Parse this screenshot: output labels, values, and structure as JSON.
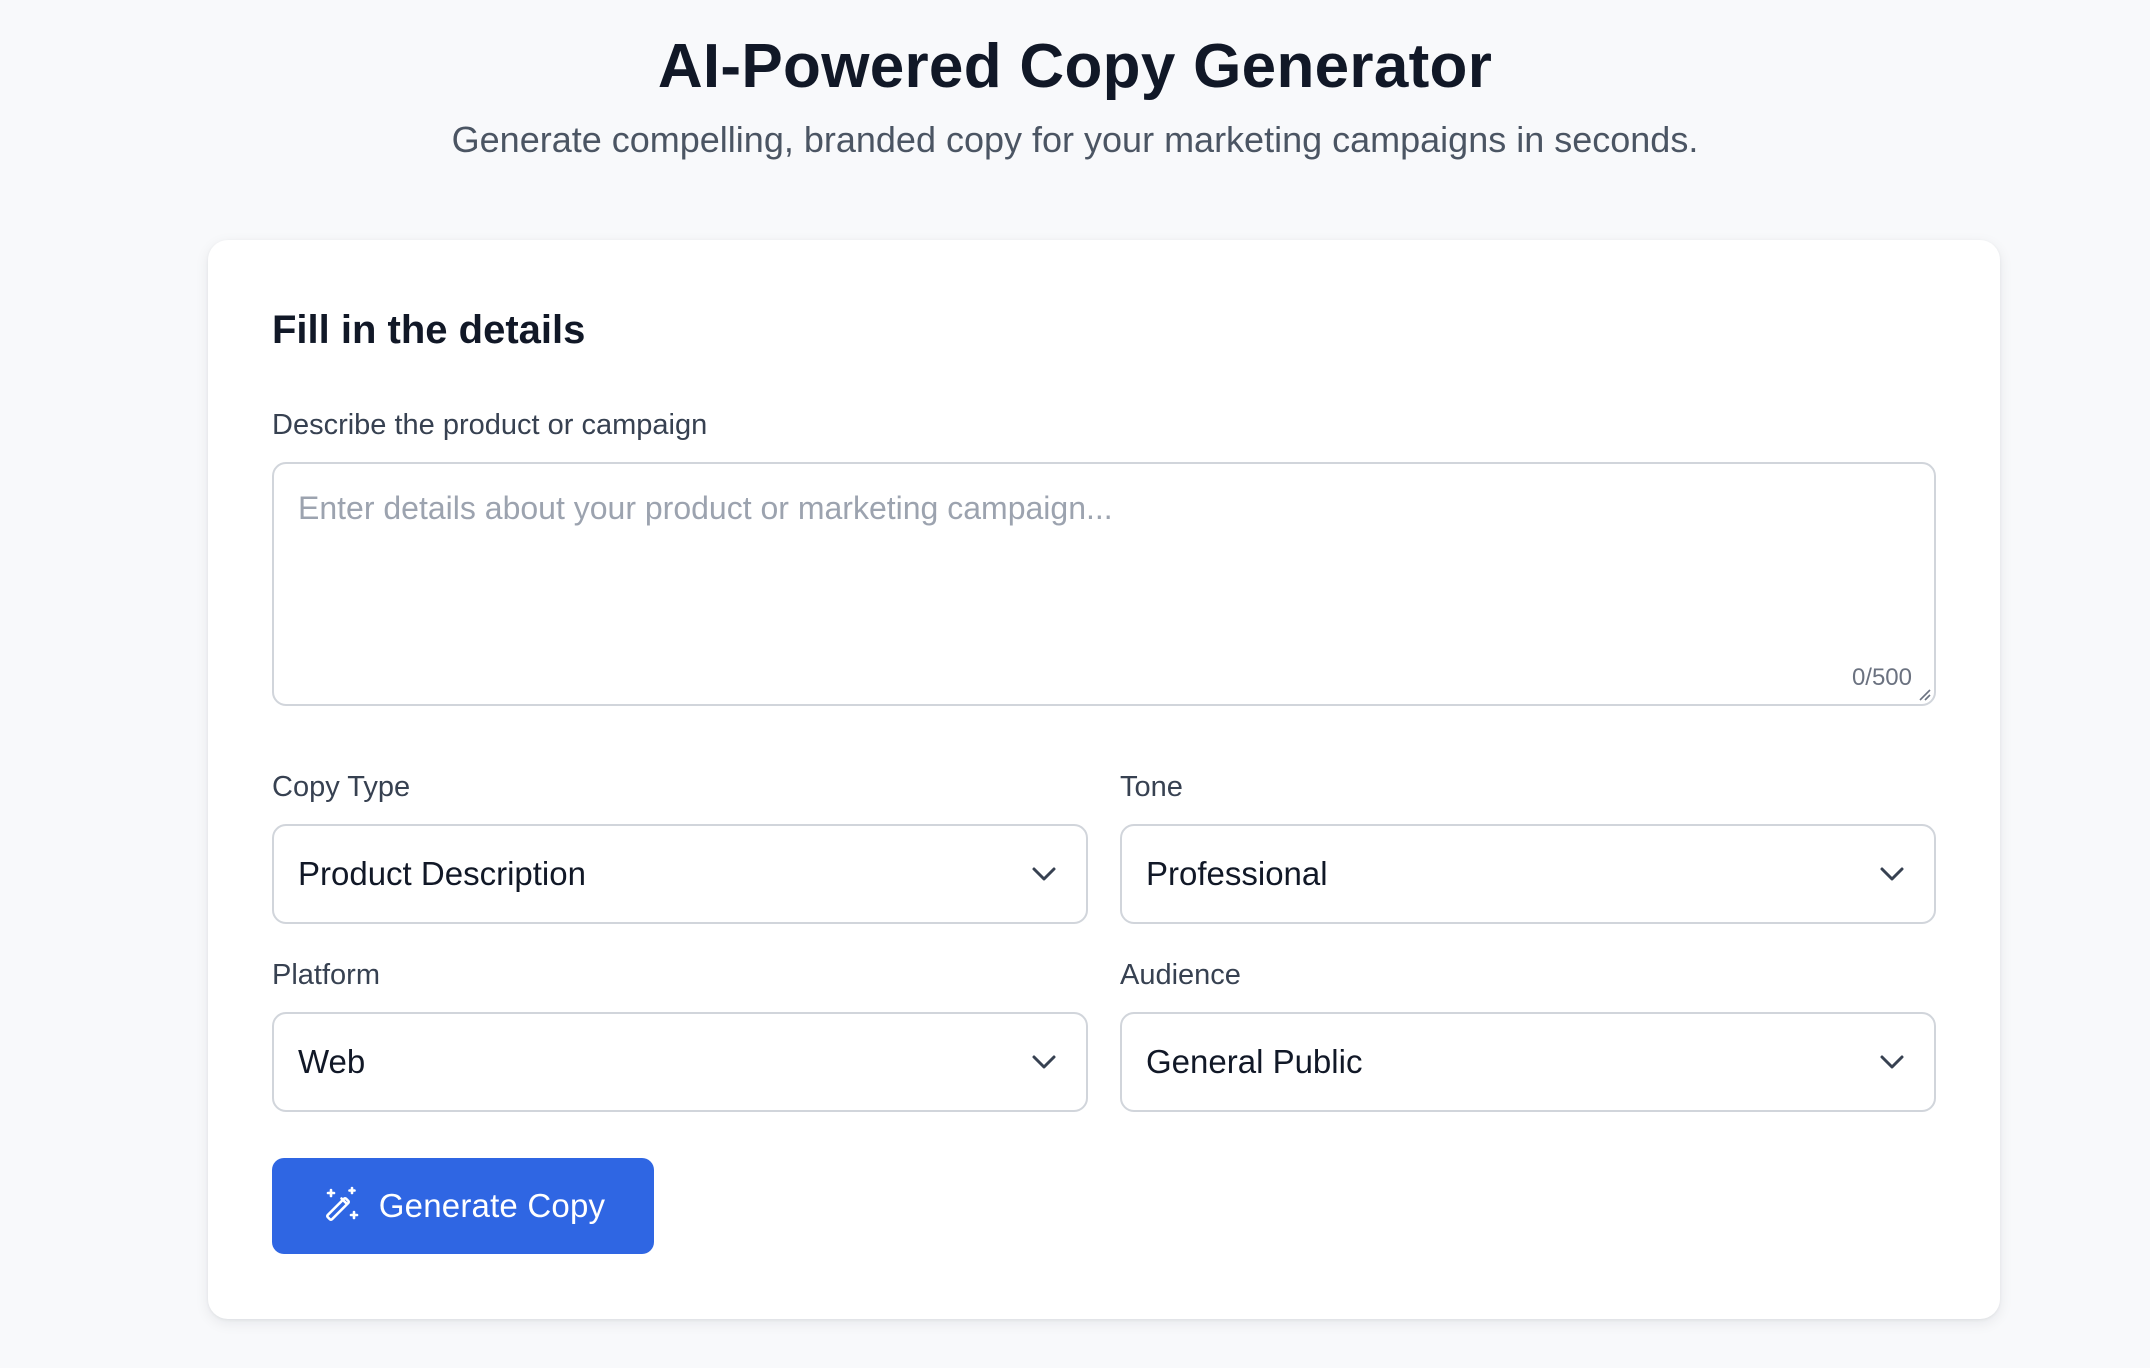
{
  "header": {
    "title": "AI-Powered Copy Generator",
    "subtitle": "Generate compelling, branded copy for your marketing campaigns in seconds."
  },
  "form": {
    "title": "Fill in the details",
    "description": {
      "label": "Describe the product or campaign",
      "placeholder": "Enter details about your product or marketing campaign...",
      "value": "",
      "char_count": "0/500"
    },
    "copy_type": {
      "label": "Copy Type",
      "selected": "Product Description"
    },
    "tone": {
      "label": "Tone",
      "selected": "Professional"
    },
    "platform": {
      "label": "Platform",
      "selected": "Web"
    },
    "audience": {
      "label": "Audience",
      "selected": "General Public"
    },
    "generate_button": {
      "label": "Generate Copy",
      "icon": "magic-wand-icon"
    }
  },
  "colors": {
    "background": "#f8f9fb",
    "card": "#ffffff",
    "primary": "#2f66e3",
    "border": "#d1d5db",
    "text": "#111827",
    "muted": "#4b5563"
  }
}
